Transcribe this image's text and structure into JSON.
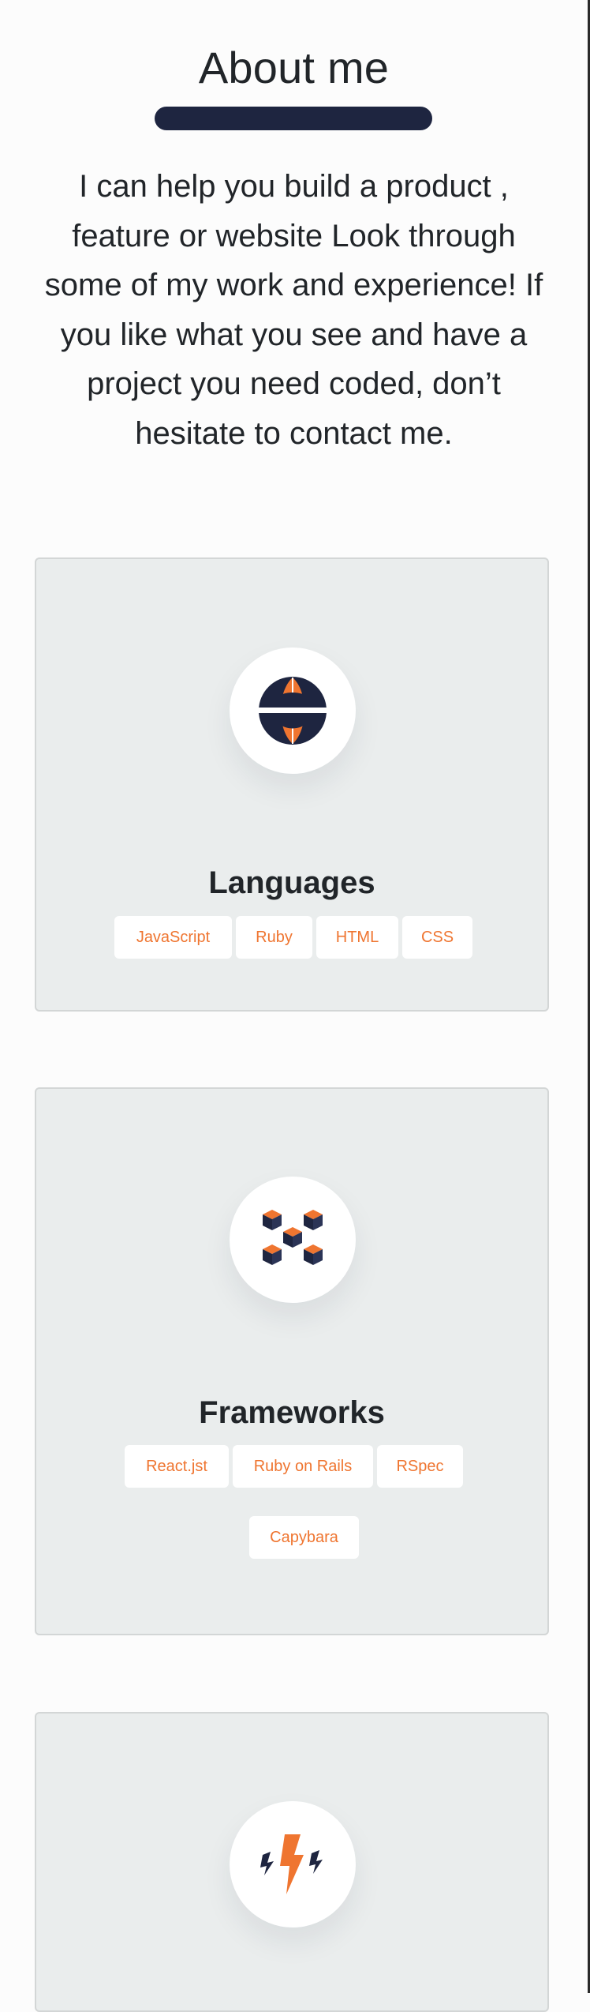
{
  "about": {
    "title": "About me",
    "intro": "I can help you build a product , feature or website Look through some of my work and experience! If you like what you see and have a project you need coded, don’t hesitate to contact me."
  },
  "skills": [
    {
      "title": "Languages",
      "icon": "globe-icon",
      "tags": [
        "JavaScript",
        "Ruby",
        "HTML",
        "CSS"
      ]
    },
    {
      "title": "Frameworks",
      "icon": "cubes-icon",
      "tags": [
        "React.jst",
        "Ruby on Rails",
        "RSpec",
        "Capybara"
      ]
    },
    {
      "title": "",
      "icon": "lightning-icon",
      "tags": []
    }
  ],
  "colors": {
    "accent": "#ef7530",
    "navy": "#1e2540",
    "card_bg": "#eaeded",
    "page_bg": "#fcfcfc"
  }
}
